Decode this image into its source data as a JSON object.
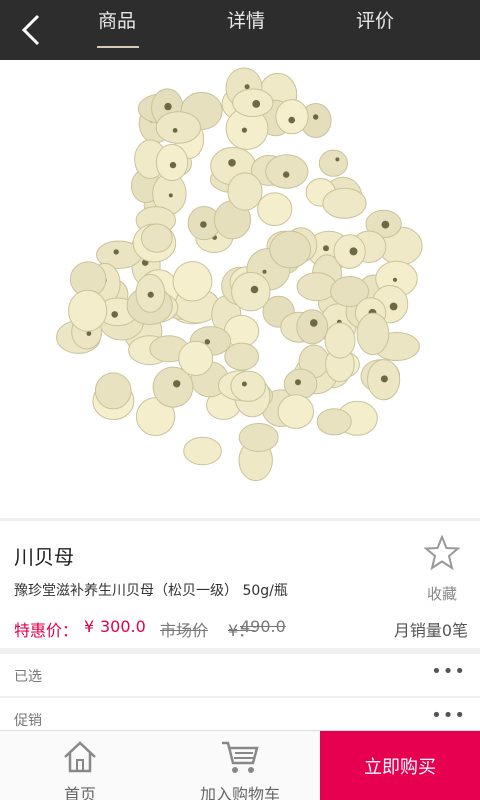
{
  "header": {
    "tabs": [
      {
        "label": "商品",
        "active": true
      },
      {
        "label": "详情",
        "active": false
      },
      {
        "label": "评价",
        "active": false
      }
    ]
  },
  "product": {
    "name": "川贝母",
    "subtitle": "豫珍堂滋补养生川贝母（松贝一级） 50g/瓶",
    "favorite_label": "收藏",
    "price_label": "特惠价：",
    "currency": "¥",
    "price": "300.0",
    "market_label": "市场价",
    "market_currency": "¥：",
    "market_price": "490.0",
    "monthly_sales": "月销量0笔"
  },
  "options": {
    "selected_label": "已选",
    "promo_label": "促销",
    "more_glyph": "•••"
  },
  "bottom_bar": {
    "home_label": "首页",
    "cart_label": "加入购物车",
    "buy_label": "立即购买"
  },
  "colors": {
    "accent": "#e6004f",
    "price": "#e0004e",
    "header_bg": "#2d2d2d"
  }
}
